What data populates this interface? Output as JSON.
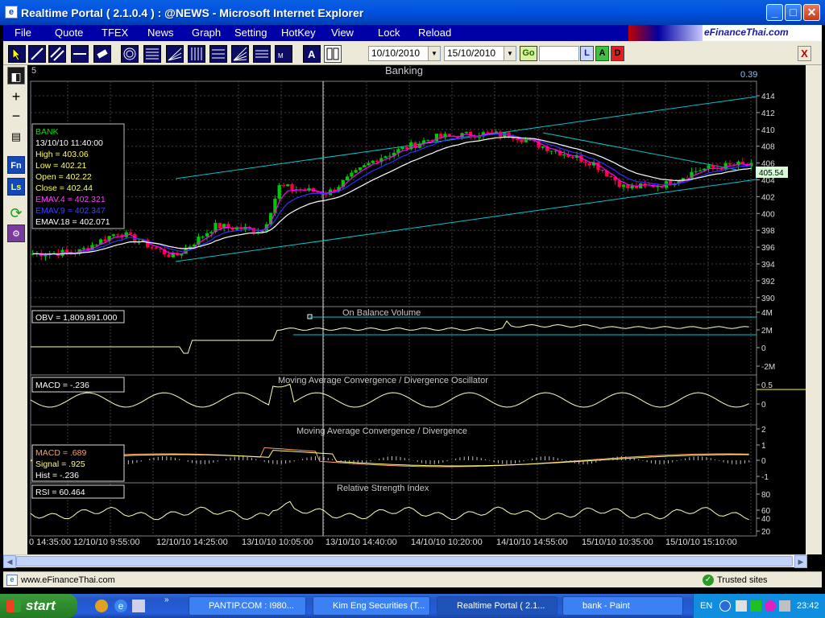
{
  "window": {
    "title": "Realtime Portal ( 2.1.0.4 ) : @NEWS - Microsoft Internet Explorer",
    "icon": "ie-page-icon"
  },
  "menu": [
    "File",
    "Quote",
    "TFEX",
    "News",
    "Graph",
    "Setting",
    "HotKey",
    "View",
    "Lock",
    "Reload"
  ],
  "banner": {
    "logo_text": "eFinanceThai.com"
  },
  "toolbar": {
    "date_from": "10/10/2010",
    "date_to": "15/10/2010",
    "go_label": "Go",
    "search_value": "",
    "letter_buttons": [
      "L",
      "A",
      "D"
    ],
    "close_label": "X"
  },
  "sidebar": {
    "fn_label": "Fn",
    "ls_label": "Ls"
  },
  "chart": {
    "interval": "5",
    "title": "Banking",
    "corner_value": "0.39",
    "last_price_tag": "405.54",
    "main_info": [
      "BANK",
      "13/10/10 11:40:00",
      "High  = 403.06",
      "Low   = 402.21",
      "Open = 402.22",
      "Close = 402.44",
      "EMAV.4 = 402.321",
      "EMAV.9 = 402.347",
      "EMAV.18 = 402.071"
    ],
    "price_ticks": [
      "414",
      "412",
      "410",
      "408",
      "406",
      "404",
      "402",
      "400",
      "398",
      "396",
      "394",
      "392",
      "390"
    ],
    "obv": {
      "label": "OBV = 1,809,891.000",
      "title": "On Balance Volume",
      "ticks": [
        "4M",
        "2M",
        "0",
        "-2M"
      ]
    },
    "macd_osc": {
      "label": "MACD = -.236",
      "title": "Moving Average Convergence / Divergence Oscillator",
      "ticks": [
        "0.5",
        "0"
      ]
    },
    "macd": {
      "lines": [
        "MACD = .689",
        "Signal = .925",
        "Hist = -.236"
      ],
      "title": "Moving Average Convergence / Divergence",
      "ticks": [
        "2",
        "1",
        "0",
        "-1"
      ]
    },
    "rsi": {
      "label": "RSI = 60.464",
      "title": "Relative Strength Index",
      "ticks": [
        "80",
        "60",
        "40",
        "20"
      ]
    },
    "time_ticks": [
      "0 14:35:00",
      "12/10/10 9:55:00",
      "12/10/10 14:25:00",
      "13/10/10 10:05:00",
      "13/10/10 14:40:00",
      "14/10/10 10:20:00",
      "14/10/10 14:55:00",
      "15/10/10 10:35:00",
      "15/10/10 15:10:00"
    ],
    "colors": {
      "up": "#00c800",
      "down": "#ff0040",
      "ema4": "#ff00ff",
      "ema9": "#3030ff",
      "ema18": "#ffffff",
      "channel": "#00c8d0",
      "grid": "#404040",
      "osc": "#ffffc0"
    }
  },
  "status": {
    "url": "www.eFinanceThai.com",
    "zone": "Trusted sites"
  },
  "taskbar": {
    "start": "start",
    "tasks": [
      "PANTIP.COM : I980...",
      "Kim Eng Securities (T...",
      "Realtime Portal ( 2.1...",
      "bank - Paint"
    ],
    "lang": "EN",
    "clock": "23:42"
  }
}
